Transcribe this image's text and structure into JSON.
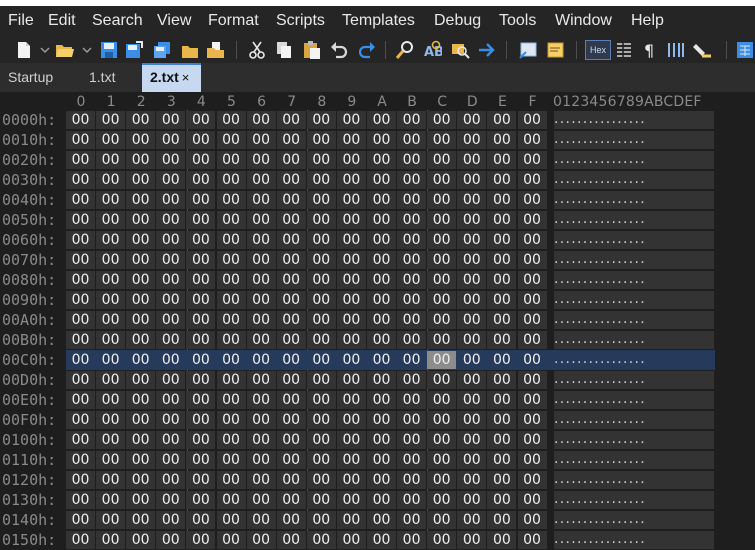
{
  "menu": {
    "items": [
      "File",
      "Edit",
      "Search",
      "View",
      "Format",
      "Scripts",
      "Templates",
      "Debug",
      "Tools",
      "Window",
      "Help"
    ]
  },
  "toolbar": {
    "icons": [
      "new-file-icon",
      "open-folder-icon",
      "save-icon",
      "save-as-icon",
      "save-all-icon",
      "open-workspace-icon",
      "copy-files-icon",
      "cut-icon",
      "copy-icon",
      "paste-icon",
      "undo-icon",
      "redo-icon",
      "find-icon",
      "replace-icon",
      "find-in-files-icon",
      "goto-icon",
      "comment-icon",
      "bookmark-icon",
      "hex-mode-icon",
      "text-columns-icon",
      "pilcrow-icon",
      "column-mode-icon",
      "highlight-icon",
      "calculator-icon"
    ],
    "hex_label": "Hex"
  },
  "tabs": [
    {
      "label": "Startup",
      "active": false
    },
    {
      "label": "1.txt",
      "active": false
    },
    {
      "label": "2.txt",
      "active": true,
      "close": "×"
    }
  ],
  "editor": {
    "column_headers": [
      "0",
      "1",
      "2",
      "3",
      "4",
      "5",
      "6",
      "7",
      "8",
      "9",
      "A",
      "B",
      "C",
      "D",
      "E",
      "F"
    ],
    "ascii_header": "0123456789ABCDEF",
    "addresses": [
      "0000h:",
      "0010h:",
      "0020h:",
      "0030h:",
      "0040h:",
      "0050h:",
      "0060h:",
      "0070h:",
      "0080h:",
      "0090h:",
      "00A0h:",
      "00B0h:",
      "00C0h:",
      "00D0h:",
      "00E0h:",
      "00F0h:",
      "0100h:",
      "0110h:",
      "0120h:",
      "0130h:",
      "0140h:",
      "0150h:"
    ],
    "byte_value": "00",
    "ascii_value": "................",
    "selected_row": 12,
    "cursor_column": 12,
    "colors": {
      "selected_row_bg": "#263a5c",
      "cursor_bg": "#8c8c8c",
      "active_tab_bg": "#c6d9f1"
    }
  }
}
